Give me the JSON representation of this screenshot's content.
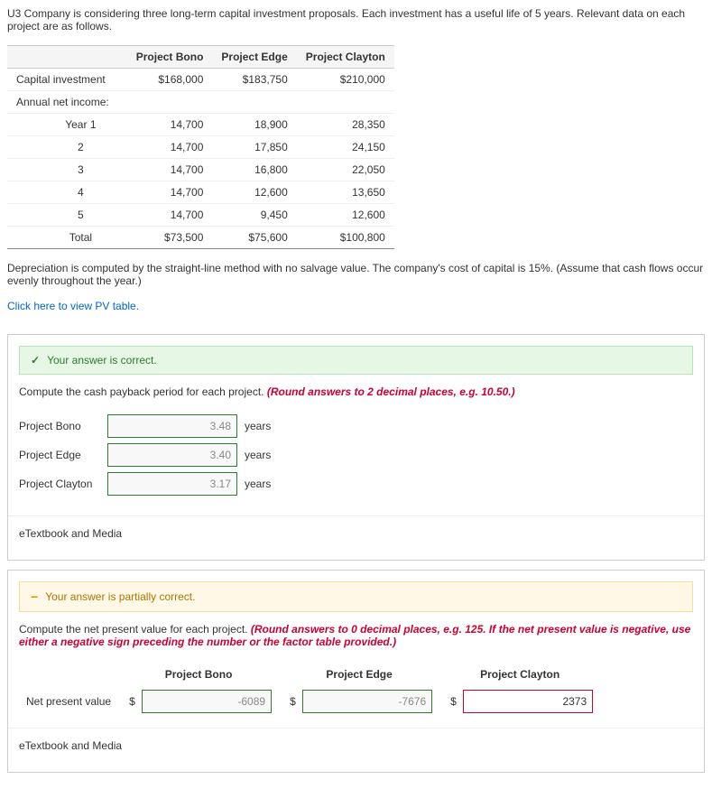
{
  "intro": "U3 Company is considering three long-term capital investment proposals. Each investment has a useful life of 5 years. Relevant data on each project are as follows.",
  "cols": {
    "blank": "",
    "a": "Project Bono",
    "b": "Project Edge",
    "c": "Project Clayton"
  },
  "rows": {
    "cap_label": "Capital investment",
    "cap_a": "$168,000",
    "cap_b": "$183,750",
    "cap_c": "$210,000",
    "ani_label": "Annual net income:",
    "y1": "Year 1",
    "y2": "2",
    "y3": "3",
    "y4": "4",
    "y5": "5",
    "a1": "14,700",
    "b1": "18,900",
    "c1": "28,350",
    "a2": "14,700",
    "b2": "17,850",
    "c2": "24,150",
    "a3": "14,700",
    "b3": "16,800",
    "c3": "22,050",
    "a4": "14,700",
    "b4": "12,600",
    "c4": "13,650",
    "a5": "14,700",
    "b5": "9,450",
    "c5": "12,600",
    "total_label": "Total",
    "ta": "$73,500",
    "tb": "$75,600",
    "tc": "$100,800"
  },
  "note": "Depreciation is computed by the straight-line method with no salvage value. The company's cost of capital is 15%. (Assume that cash flows occur evenly throughout the year.)",
  "pv_link": "Click here to view PV table.",
  "q1": {
    "feedback": "Your answer is correct.",
    "prompt_a": "Compute the cash payback period for each project. ",
    "prompt_b": "(Round answers to 2 decimal places, e.g. 10.50.)",
    "labels": {
      "a": "Project Bono",
      "b": "Project Edge",
      "c": "Project Clayton"
    },
    "vals": {
      "a": "3.48",
      "b": "3.40",
      "c": "3.17"
    },
    "unit": "years"
  },
  "q2": {
    "feedback": "Your answer is partially correct.",
    "prompt_a": "Compute the net present value for each project. ",
    "prompt_b": "(Round answers to 0 decimal places, e.g. 125. If the net present value is negative, use either a negative sign preceding the number or the factor table provided.)",
    "cols": {
      "a": "Project Bono",
      "b": "Project Edge",
      "c": "Project Clayton"
    },
    "row_label": "Net present value",
    "dollar": "$",
    "vals": {
      "a": "-6089",
      "b": "-7676",
      "c": "2373"
    }
  },
  "etext": "eTextbook and Media"
}
